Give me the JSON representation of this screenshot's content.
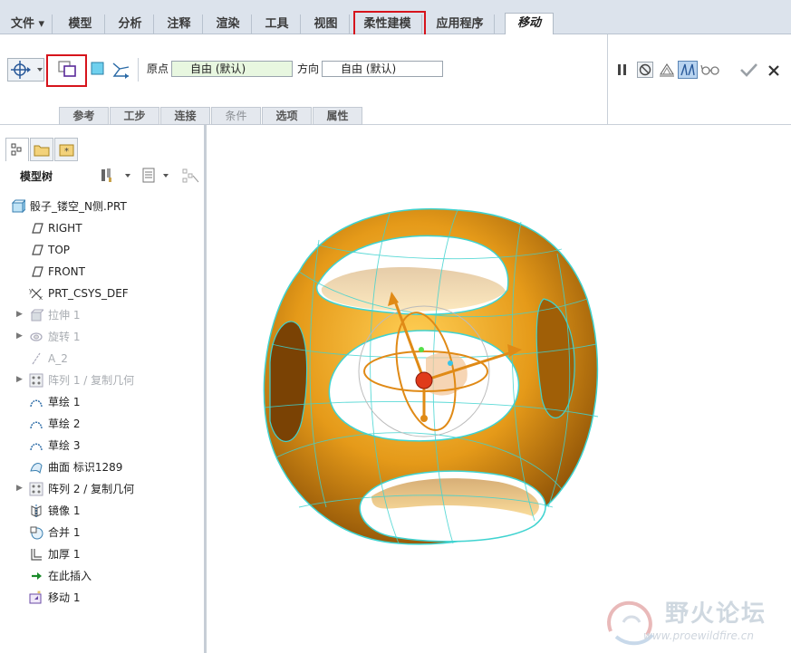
{
  "menu": {
    "tabs": [
      {
        "label": "文件 ▾"
      },
      {
        "label": "模型"
      },
      {
        "label": "分析"
      },
      {
        "label": "注释"
      },
      {
        "label": "渲染"
      },
      {
        "label": "工具"
      },
      {
        "label": "视图"
      },
      {
        "label": "柔性建模"
      },
      {
        "label": "应用程序"
      },
      {
        "label": "移动"
      }
    ],
    "active_tab": "移动",
    "highlighted_tab": "柔性建模"
  },
  "ribbon": {
    "origin_label": "原点",
    "origin_value": "自由 (默认)",
    "direction_label": "方向",
    "direction_value": "自由 (默认)",
    "subtabs": [
      {
        "label": "参考"
      },
      {
        "label": "工步"
      },
      {
        "label": "连接"
      },
      {
        "label": "条件"
      },
      {
        "label": "选项"
      },
      {
        "label": "属性"
      }
    ]
  },
  "model_tree": {
    "title": "模型树",
    "items": [
      {
        "label": "骰子_镂空_N侧.PRT",
        "icon": "part-icon",
        "dim": false,
        "expandable": false
      },
      {
        "label": "RIGHT",
        "icon": "datum-plane-icon",
        "dim": false,
        "expandable": false
      },
      {
        "label": "TOP",
        "icon": "datum-plane-icon",
        "dim": false,
        "expandable": false
      },
      {
        "label": "FRONT",
        "icon": "datum-plane-icon",
        "dim": false,
        "expandable": false
      },
      {
        "label": "PRT_CSYS_DEF",
        "icon": "csys-icon",
        "dim": false,
        "expandable": false
      },
      {
        "label": "拉伸 1",
        "icon": "extrude-icon",
        "dim": true,
        "expandable": true
      },
      {
        "label": "旋转 1",
        "icon": "revolve-icon",
        "dim": true,
        "expandable": true
      },
      {
        "label": "A_2",
        "icon": "axis-icon",
        "dim": true,
        "expandable": false
      },
      {
        "label": "阵列 1 / 复制几何",
        "icon": "pattern-icon",
        "dim": true,
        "expandable": true
      },
      {
        "label": "草绘 1",
        "icon": "sketch-icon",
        "dim": false,
        "expandable": false
      },
      {
        "label": "草绘 2",
        "icon": "sketch-icon",
        "dim": false,
        "expandable": false
      },
      {
        "label": "草绘 3",
        "icon": "sketch-icon",
        "dim": false,
        "expandable": false
      },
      {
        "label": "曲面 标识1289",
        "icon": "surface-icon",
        "dim": false,
        "expandable": false
      },
      {
        "label": "阵列 2 / 复制几何",
        "icon": "pattern-icon",
        "dim": false,
        "expandable": true
      },
      {
        "label": "镜像 1",
        "icon": "mirror-icon",
        "dim": false,
        "expandable": false
      },
      {
        "label": "合并 1",
        "icon": "merge-icon",
        "dim": false,
        "expandable": false
      },
      {
        "label": "加厚 1",
        "icon": "thicken-icon",
        "dim": false,
        "expandable": false
      },
      {
        "label": "在此插入",
        "icon": "insert-arrow-icon",
        "dim": false,
        "expandable": false
      },
      {
        "label": "移动 1",
        "icon": "move-icon",
        "dim": false,
        "expandable": false
      }
    ]
  },
  "watermark": {
    "title": "野火论坛",
    "url": "www.proewildfire.cn"
  },
  "colors": {
    "accent_red": "#d6141c",
    "model_orange": "#e39a1c",
    "wire_cyan": "#35d2d0"
  }
}
